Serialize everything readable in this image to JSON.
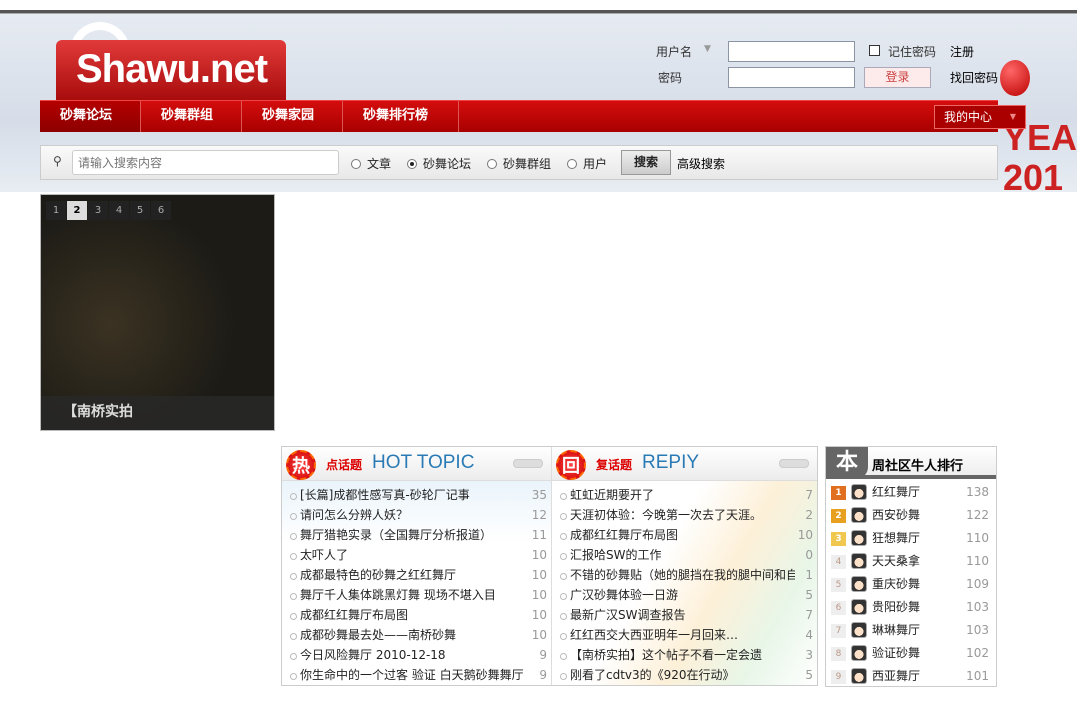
{
  "logo": "Shawu.net",
  "login": {
    "username_label": "用户名",
    "password_label": "密码",
    "username_value": "",
    "password_value": "",
    "remember_label": "记住密码",
    "register": "注册",
    "login_button": "登录",
    "forgot": "找回密码"
  },
  "nav": {
    "items": [
      "砂舞论坛",
      "砂舞群组",
      "砂舞家园",
      "砂舞排行榜"
    ],
    "my_center": "我的中心"
  },
  "search": {
    "placeholder": "请输入搜索内容",
    "options": [
      "文章",
      "砂舞论坛",
      "砂舞群组",
      "用户"
    ],
    "selected": "砂舞论坛",
    "button": "搜索",
    "advanced": "高级搜索"
  },
  "slideshow": {
    "pages": [
      "1",
      "2",
      "3",
      "4",
      "5",
      "6"
    ],
    "current": "2",
    "caption": "【南桥实拍"
  },
  "hot": {
    "badge": "热",
    "title_cn": "点话题",
    "title_en": "HOT TOPIC",
    "items": [
      {
        "t": "[长篇]成都性感写真-砂轮厂记事",
        "c": "35"
      },
      {
        "t": "请问怎么分辨人妖？",
        "c": "12"
      },
      {
        "t": "舞厅猎艳实录（全国舞厅分析报道）",
        "c": "11"
      },
      {
        "t": "太吓人了",
        "c": "10"
      },
      {
        "t": "成都最特色的砂舞之红红舞厅",
        "c": "10"
      },
      {
        "t": "舞厅千人集体跳黑灯舞 现场不堪入目",
        "c": "10"
      },
      {
        "t": "成都红红舞厅布局图",
        "c": "10"
      },
      {
        "t": "成都砂舞最去处——南桥砂舞",
        "c": "10"
      },
      {
        "t": "今日风险舞厅 2010-12-18",
        "c": "9"
      },
      {
        "t": "你生命中的一个过客 验证 白天鹅砂舞舞厅",
        "c": "9"
      }
    ]
  },
  "reply": {
    "badge": "回",
    "title_cn": "复话题",
    "title_en": "REPIY",
    "items": [
      {
        "t": "虹虹近期要开了",
        "c": "7"
      },
      {
        "t": "天涯初体验：今晚第一次去了天涯。",
        "c": "2"
      },
      {
        "t": "成都红红舞厅布局图",
        "c": "10"
      },
      {
        "t": "汇报哈SW的工作",
        "c": "0"
      },
      {
        "t": "不错的砂舞贴（她的腿挡在我的腿中间和自",
        "c": "1"
      },
      {
        "t": "广汉砂舞体验一日游",
        "c": "5"
      },
      {
        "t": "最新广汉SW调查报告",
        "c": "7"
      },
      {
        "t": "红红西交大西亚明年一月回来…",
        "c": "4"
      },
      {
        "t": "【南桥实拍】这个帖子不看一定会遗",
        "c": "3"
      },
      {
        "t": "刚看了cdtv3的《920在行动》",
        "c": "5"
      }
    ]
  },
  "rank": {
    "badge": "本",
    "title": "周社区牛人排行",
    "items": [
      {
        "n": "1",
        "name": "红红舞厅",
        "s": "138"
      },
      {
        "n": "2",
        "name": "西安砂舞",
        "s": "122"
      },
      {
        "n": "3",
        "name": "狂想舞厅",
        "s": "110"
      },
      {
        "n": "4",
        "name": "天天桑拿",
        "s": "110"
      },
      {
        "n": "5",
        "name": "重庆砂舞",
        "s": "109"
      },
      {
        "n": "6",
        "name": "贵阳砂舞",
        "s": "103"
      },
      {
        "n": "7",
        "name": "琳琳舞厅",
        "s": "103"
      },
      {
        "n": "8",
        "name": "验证砂舞",
        "s": "102"
      },
      {
        "n": "9",
        "name": "西亚舞厅",
        "s": "101"
      }
    ]
  },
  "colors": {
    "nav_red": "#c00000",
    "link_blue": "#2a7bb5",
    "rank1": "#e07020",
    "rank2": "#e8a020",
    "rank3": "#f0c850"
  }
}
